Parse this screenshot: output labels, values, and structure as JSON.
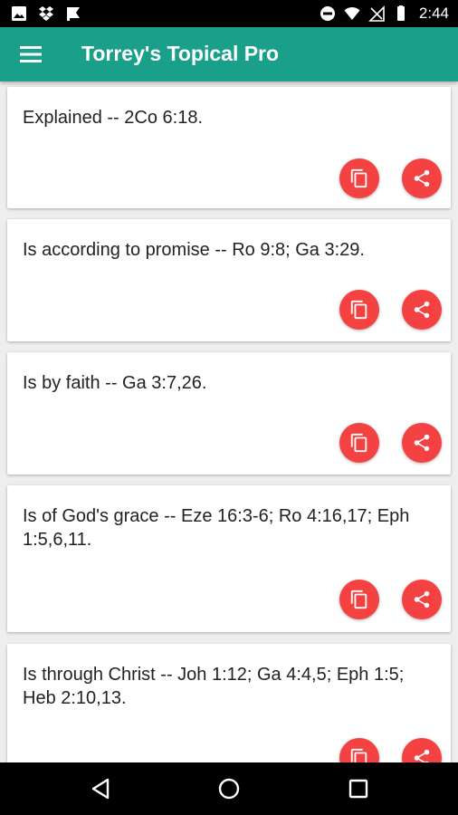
{
  "status_bar": {
    "time": "2:44",
    "left_icons": [
      "image-icon",
      "dropbox-icon",
      "flag-icon"
    ],
    "right_icons": [
      "do-not-disturb-icon",
      "wifi-icon",
      "no-signal-icon",
      "battery-icon"
    ]
  },
  "app_bar": {
    "title": "Torrey's Topical Pro",
    "menu_icon": "menu-icon"
  },
  "cards": [
    {
      "text": "Explained -- 2Co 6:18."
    },
    {
      "text": "Is according to promise -- Ro 9:8; Ga 3:29."
    },
    {
      "text": "Is by faith -- Ga 3:7,26."
    },
    {
      "text": "Is of God's grace -- Eze 16:3-6; Ro 4:16,17; Eph 1:5,6,11."
    },
    {
      "text": "Is through Christ -- Joh 1:12; Ga 4:4,5; Eph 1:5; Heb 2:10,13."
    }
  ],
  "card_actions": {
    "copy_icon": "copy-icon",
    "share_icon": "share-icon"
  },
  "colors": {
    "app_bar": "#1aa08a",
    "action_button": "#f44141",
    "background": "#eeeeee"
  },
  "nav_bar": {
    "icons": [
      "back-icon",
      "home-icon",
      "recents-icon"
    ]
  }
}
